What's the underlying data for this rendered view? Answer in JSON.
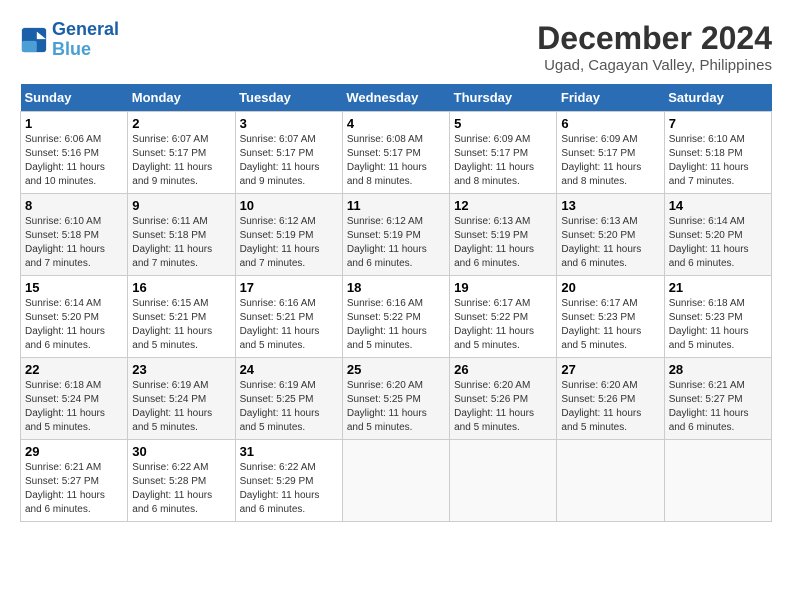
{
  "header": {
    "logo_line1": "General",
    "logo_line2": "Blue",
    "title": "December 2024",
    "subtitle": "Ugad, Cagayan Valley, Philippines"
  },
  "calendar": {
    "days_of_week": [
      "Sunday",
      "Monday",
      "Tuesday",
      "Wednesday",
      "Thursday",
      "Friday",
      "Saturday"
    ],
    "weeks": [
      [
        {
          "day": "1",
          "sunrise": "6:06 AM",
          "sunset": "5:16 PM",
          "daylight": "11 hours and 10 minutes."
        },
        {
          "day": "2",
          "sunrise": "6:07 AM",
          "sunset": "5:17 PM",
          "daylight": "11 hours and 9 minutes."
        },
        {
          "day": "3",
          "sunrise": "6:07 AM",
          "sunset": "5:17 PM",
          "daylight": "11 hours and 9 minutes."
        },
        {
          "day": "4",
          "sunrise": "6:08 AM",
          "sunset": "5:17 PM",
          "daylight": "11 hours and 8 minutes."
        },
        {
          "day": "5",
          "sunrise": "6:09 AM",
          "sunset": "5:17 PM",
          "daylight": "11 hours and 8 minutes."
        },
        {
          "day": "6",
          "sunrise": "6:09 AM",
          "sunset": "5:17 PM",
          "daylight": "11 hours and 8 minutes."
        },
        {
          "day": "7",
          "sunrise": "6:10 AM",
          "sunset": "5:18 PM",
          "daylight": "11 hours and 7 minutes."
        }
      ],
      [
        {
          "day": "8",
          "sunrise": "6:10 AM",
          "sunset": "5:18 PM",
          "daylight": "11 hours and 7 minutes."
        },
        {
          "day": "9",
          "sunrise": "6:11 AM",
          "sunset": "5:18 PM",
          "daylight": "11 hours and 7 minutes."
        },
        {
          "day": "10",
          "sunrise": "6:12 AM",
          "sunset": "5:19 PM",
          "daylight": "11 hours and 7 minutes."
        },
        {
          "day": "11",
          "sunrise": "6:12 AM",
          "sunset": "5:19 PM",
          "daylight": "11 hours and 6 minutes."
        },
        {
          "day": "12",
          "sunrise": "6:13 AM",
          "sunset": "5:19 PM",
          "daylight": "11 hours and 6 minutes."
        },
        {
          "day": "13",
          "sunrise": "6:13 AM",
          "sunset": "5:20 PM",
          "daylight": "11 hours and 6 minutes."
        },
        {
          "day": "14",
          "sunrise": "6:14 AM",
          "sunset": "5:20 PM",
          "daylight": "11 hours and 6 minutes."
        }
      ],
      [
        {
          "day": "15",
          "sunrise": "6:14 AM",
          "sunset": "5:20 PM",
          "daylight": "11 hours and 6 minutes."
        },
        {
          "day": "16",
          "sunrise": "6:15 AM",
          "sunset": "5:21 PM",
          "daylight": "11 hours and 5 minutes."
        },
        {
          "day": "17",
          "sunrise": "6:16 AM",
          "sunset": "5:21 PM",
          "daylight": "11 hours and 5 minutes."
        },
        {
          "day": "18",
          "sunrise": "6:16 AM",
          "sunset": "5:22 PM",
          "daylight": "11 hours and 5 minutes."
        },
        {
          "day": "19",
          "sunrise": "6:17 AM",
          "sunset": "5:22 PM",
          "daylight": "11 hours and 5 minutes."
        },
        {
          "day": "20",
          "sunrise": "6:17 AM",
          "sunset": "5:23 PM",
          "daylight": "11 hours and 5 minutes."
        },
        {
          "day": "21",
          "sunrise": "6:18 AM",
          "sunset": "5:23 PM",
          "daylight": "11 hours and 5 minutes."
        }
      ],
      [
        {
          "day": "22",
          "sunrise": "6:18 AM",
          "sunset": "5:24 PM",
          "daylight": "11 hours and 5 minutes."
        },
        {
          "day": "23",
          "sunrise": "6:19 AM",
          "sunset": "5:24 PM",
          "daylight": "11 hours and 5 minutes."
        },
        {
          "day": "24",
          "sunrise": "6:19 AM",
          "sunset": "5:25 PM",
          "daylight": "11 hours and 5 minutes."
        },
        {
          "day": "25",
          "sunrise": "6:20 AM",
          "sunset": "5:25 PM",
          "daylight": "11 hours and 5 minutes."
        },
        {
          "day": "26",
          "sunrise": "6:20 AM",
          "sunset": "5:26 PM",
          "daylight": "11 hours and 5 minutes."
        },
        {
          "day": "27",
          "sunrise": "6:20 AM",
          "sunset": "5:26 PM",
          "daylight": "11 hours and 5 minutes."
        },
        {
          "day": "28",
          "sunrise": "6:21 AM",
          "sunset": "5:27 PM",
          "daylight": "11 hours and 6 minutes."
        }
      ],
      [
        {
          "day": "29",
          "sunrise": "6:21 AM",
          "sunset": "5:27 PM",
          "daylight": "11 hours and 6 minutes."
        },
        {
          "day": "30",
          "sunrise": "6:22 AM",
          "sunset": "5:28 PM",
          "daylight": "11 hours and 6 minutes."
        },
        {
          "day": "31",
          "sunrise": "6:22 AM",
          "sunset": "5:29 PM",
          "daylight": "11 hours and 6 minutes."
        },
        null,
        null,
        null,
        null
      ]
    ]
  }
}
